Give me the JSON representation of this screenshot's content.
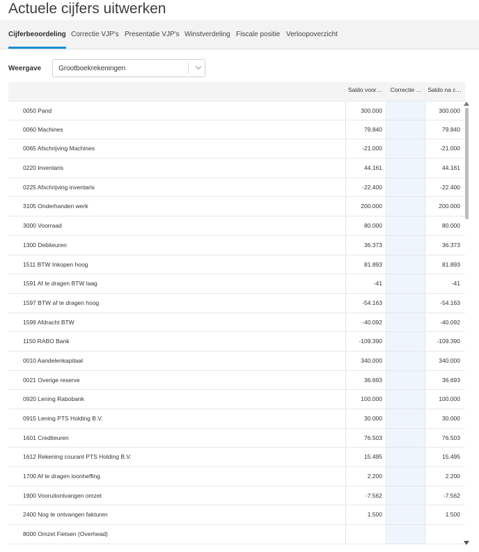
{
  "page": {
    "title": "Actuele cijfers uitwerken"
  },
  "tabs": [
    {
      "label": "Cijferbeoordeling",
      "active": true
    },
    {
      "label": "Correctie VJP's",
      "active": false
    },
    {
      "label": "Presentatie VJP's",
      "active": false
    },
    {
      "label": "Winstverdeling",
      "active": false
    },
    {
      "label": "Fiscale positie",
      "active": false
    },
    {
      "label": "Verloopoverzicht",
      "active": false
    }
  ],
  "filter": {
    "label": "Weergave",
    "selected": "Grootboekrekeningen"
  },
  "grid": {
    "columns": {
      "before": "Saldo voor correctie",
      "correction": "Correctie VJP",
      "after": "Saldo na correctie"
    },
    "columns_display": {
      "before": "Saldo voor…",
      "correction": "Correctie …",
      "after": "Saldo na c…"
    },
    "rows": [
      {
        "name": "0050 Pand",
        "before": "300.000",
        "correction": "",
        "after": "300.000"
      },
      {
        "name": "0060 Machines",
        "before": "79.840",
        "correction": "",
        "after": "79.840"
      },
      {
        "name": "0065 Afschrijving Machines",
        "before": "-21.000",
        "correction": "",
        "after": "-21.000"
      },
      {
        "name": "0220 Inventaris",
        "before": "44.161",
        "correction": "",
        "after": "44.161"
      },
      {
        "name": "0225 Afschrijving inventaris",
        "before": "-22.400",
        "correction": "",
        "after": "-22.400"
      },
      {
        "name": "3105 Onderhanden werk",
        "before": "200.000",
        "correction": "",
        "after": "200.000"
      },
      {
        "name": "3000 Voorraad",
        "before": "80.000",
        "correction": "",
        "after": "80.000"
      },
      {
        "name": "1300 Debiteuren",
        "before": "36.373",
        "correction": "",
        "after": "36.373"
      },
      {
        "name": "1511 BTW Inkopen hoog",
        "before": "81.893",
        "correction": "",
        "after": "81.893"
      },
      {
        "name": "1591 Af te dragen BTW laag",
        "before": "-41",
        "correction": "",
        "after": "-41"
      },
      {
        "name": "1597 BTW af te dragen hoog",
        "before": "-54.163",
        "correction": "",
        "after": "-54.163"
      },
      {
        "name": "1599 Afdracht BTW",
        "before": "-40.092",
        "correction": "",
        "after": "-40.092"
      },
      {
        "name": "1150 RABO Bank",
        "before": "-109.390",
        "correction": "",
        "after": "-109.390"
      },
      {
        "name": "0010 Aandelenkapitaal",
        "before": "340.000",
        "correction": "",
        "after": "340.000"
      },
      {
        "name": "0021 Overige reserve",
        "before": "36.693",
        "correction": "",
        "after": "36.693"
      },
      {
        "name": "0920 Lening Rabobank",
        "before": "100.000",
        "correction": "",
        "after": "100.000"
      },
      {
        "name": "0915 Lening PTS Holding B.V.",
        "before": "30.000",
        "correction": "",
        "after": "30.000"
      },
      {
        "name": "1601 Crediteuren",
        "before": "76.503",
        "correction": "",
        "after": "76.503"
      },
      {
        "name": "1612 Rekening courant PTS Holding B.V.",
        "before": "15.495",
        "correction": "",
        "after": "15.495"
      },
      {
        "name": "1700 Af te dragen loonheffing",
        "before": "2.200",
        "correction": "",
        "after": "2.200"
      },
      {
        "name": "1900 Vooruitontvangen omzet",
        "before": "-7.562",
        "correction": "",
        "after": "-7.562"
      },
      {
        "name": "2400 Nog te ontvangen fakturen",
        "before": "1.500",
        "correction": "",
        "after": "1.500"
      },
      {
        "name": "8000 Omzet Fietsen (Overhead)",
        "before": "",
        "correction": "",
        "after": ""
      }
    ]
  },
  "colors": {
    "accent": "#1a8fd6",
    "tab_bar_bg": "#f3f3f3",
    "correction_col_bg": "#eef5fd"
  },
  "icons": {
    "select_chevron": "chevron-down-icon",
    "scroll_up": "triangle-up-icon",
    "scroll_down": "triangle-down-icon"
  }
}
